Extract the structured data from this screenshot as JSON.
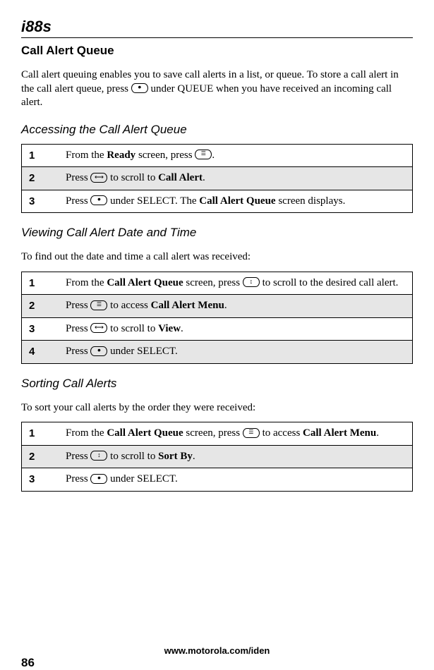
{
  "brand": "i88s",
  "heading": "Call Alert Queue",
  "intro": {
    "part1": "Call alert queuing enables you to save call alerts in a list, or queue. To store a call alert in the call alert queue, press ",
    "part2": " under QUEUE when you have received an incoming call alert."
  },
  "section1": {
    "title": "Accessing the Call Alert Queue",
    "steps": [
      {
        "num": "1",
        "p1": "From the ",
        "b1": "Ready",
        "p2": " screen, press ",
        "p3": "."
      },
      {
        "num": "2",
        "p1": "Press ",
        "p2": " to scroll to ",
        "b1": "Call Alert",
        "p3": "."
      },
      {
        "num": "3",
        "p1": "Press ",
        "p2": " under SELECT. The ",
        "b1": "Call Alert Queue",
        "p3": " screen displays."
      }
    ]
  },
  "section2": {
    "title": "Viewing Call Alert Date and Time",
    "desc": "To find out the date and time a call alert was received:",
    "steps": [
      {
        "num": "1",
        "p1": "From the ",
        "b1": "Call Alert Queue",
        "p2": " screen, press ",
        "p3": " to scroll to the desired call alert."
      },
      {
        "num": "2",
        "p1": "Press ",
        "p2": " to access ",
        "b1": "Call Alert Menu",
        "p3": "."
      },
      {
        "num": "3",
        "p1": "Press ",
        "p2": " to scroll to ",
        "b1": "View",
        "p3": "."
      },
      {
        "num": "4",
        "p1": "Press ",
        "p2": " under SELECT."
      }
    ]
  },
  "section3": {
    "title": "Sorting Call Alerts",
    "desc": "To sort your call alerts by the order they were received:",
    "steps": [
      {
        "num": "1",
        "p1": "From the ",
        "b1": "Call Alert Queue",
        "p2": " screen, press ",
        "p3": " to access ",
        "b2": "Call Alert Menu",
        "p4": "."
      },
      {
        "num": "2",
        "p1": "Press ",
        "p2": " to scroll to ",
        "b1": "Sort By",
        "p3": "."
      },
      {
        "num": "3",
        "p1": "Press ",
        "p2": " under SELECT."
      }
    ]
  },
  "footer": "www.motorola.com/iden",
  "pageNum": "86"
}
